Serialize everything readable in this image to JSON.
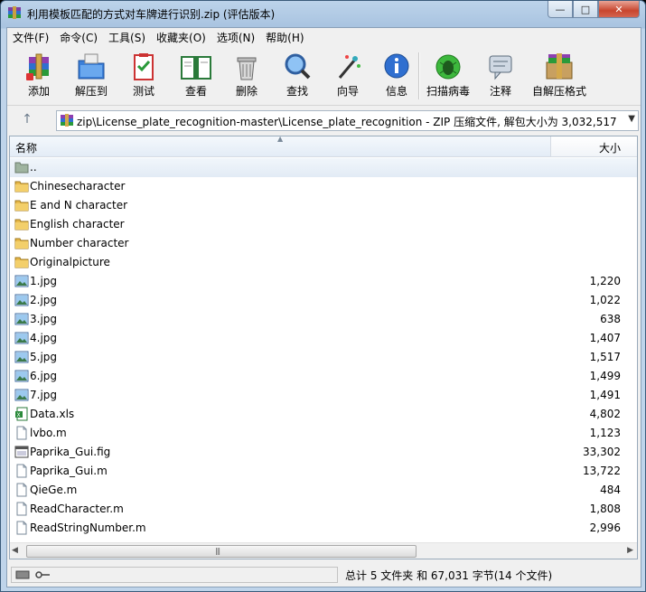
{
  "window": {
    "title": "利用模板匹配的方式对车牌进行识别.zip (评估版本)",
    "buttons": {
      "minimize": "—",
      "maximize": "□",
      "close": "✕"
    }
  },
  "menu": [
    "文件(F)",
    "命令(C)",
    "工具(S)",
    "收藏夹(O)",
    "选项(N)",
    "帮助(H)"
  ],
  "toolbar": [
    {
      "label": "添加",
      "icon": "add-archive-icon"
    },
    {
      "label": "解压到",
      "icon": "extract-to-icon"
    },
    {
      "label": "测试",
      "icon": "test-icon"
    },
    {
      "label": "查看",
      "icon": "view-book-icon"
    },
    {
      "label": "删除",
      "icon": "trash-icon"
    },
    {
      "label": "查找",
      "icon": "magnifier-icon"
    },
    {
      "label": "向导",
      "icon": "wizard-wand-icon"
    },
    {
      "label": "信息",
      "icon": "info-icon"
    },
    {
      "label": "扫描病毒",
      "icon": "virus-scan-icon"
    },
    {
      "label": "注释",
      "icon": "comment-icon"
    },
    {
      "label": "自解压格式",
      "icon": "sfx-box-icon"
    }
  ],
  "address": {
    "path": "zip\\License_plate_recognition-master\\License_plate_recognition - ZIP 压缩文件, 解包大小为 3,032,517 字节"
  },
  "columns": {
    "name": "名称",
    "size": "大小"
  },
  "files": [
    {
      "name": "..",
      "size": "",
      "type": "parent"
    },
    {
      "name": "Chinesecharacter",
      "size": "",
      "type": "folder"
    },
    {
      "name": "E and N character",
      "size": "",
      "type": "folder"
    },
    {
      "name": "English character",
      "size": "",
      "type": "folder"
    },
    {
      "name": "Number character",
      "size": "",
      "type": "folder"
    },
    {
      "name": "Originalpicture",
      "size": "",
      "type": "folder"
    },
    {
      "name": "1.jpg",
      "size": "1,220",
      "type": "image"
    },
    {
      "name": "2.jpg",
      "size": "1,022",
      "type": "image"
    },
    {
      "name": "3.jpg",
      "size": "638",
      "type": "image"
    },
    {
      "name": "4.jpg",
      "size": "1,407",
      "type": "image"
    },
    {
      "name": "5.jpg",
      "size": "1,517",
      "type": "image"
    },
    {
      "name": "6.jpg",
      "size": "1,499",
      "type": "image"
    },
    {
      "name": "7.jpg",
      "size": "1,491",
      "type": "image"
    },
    {
      "name": "Data.xls",
      "size": "4,802",
      "type": "excel"
    },
    {
      "name": "lvbo.m",
      "size": "1,123",
      "type": "mfile"
    },
    {
      "name": "Paprika_Gui.fig",
      "size": "33,302",
      "type": "fig"
    },
    {
      "name": "Paprika_Gui.m",
      "size": "13,722",
      "type": "mfile"
    },
    {
      "name": "QieGe.m",
      "size": "484",
      "type": "mfile"
    },
    {
      "name": "ReadCharacter.m",
      "size": "1,808",
      "type": "mfile"
    },
    {
      "name": "ReadStringNumber.m",
      "size": "2,996",
      "type": "mfile"
    }
  ],
  "status": {
    "summary": "总计 5 文件夹 和 67,031 字节(14 个文件)"
  },
  "colors": {
    "selection": "#e2ebf5",
    "folder": "#e8b94a",
    "title_bar": "#a8c3e0"
  }
}
